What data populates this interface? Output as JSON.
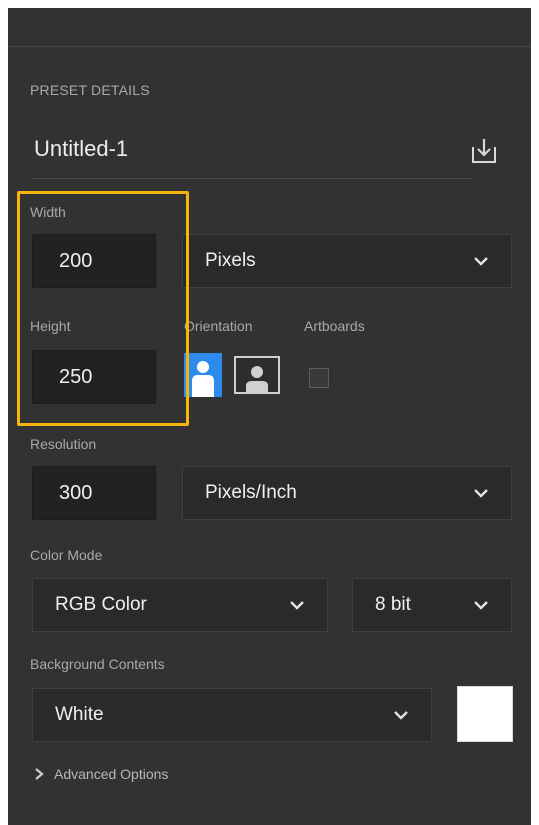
{
  "panel": {
    "section_title": "PRESET DETAILS",
    "document_name": "Untitled-1",
    "width": {
      "label": "Width",
      "value": "200"
    },
    "units": {
      "value": "Pixels"
    },
    "height": {
      "label": "Height",
      "value": "250"
    },
    "orientation": {
      "label": "Orientation",
      "selected": "portrait"
    },
    "artboards": {
      "label": "Artboards",
      "checked": false
    },
    "resolution": {
      "label": "Resolution",
      "value": "300",
      "unit": "Pixels/Inch"
    },
    "color_mode": {
      "label": "Color Mode",
      "value": "RGB Color",
      "depth": "8 bit"
    },
    "background": {
      "label": "Background Contents",
      "value": "White",
      "swatch_color": "#ffffff"
    },
    "advanced": {
      "label": "Advanced Options"
    }
  },
  "colors": {
    "highlight": "#f6b40d",
    "accent": "#2d8ceb",
    "panel_bg": "#323232"
  }
}
